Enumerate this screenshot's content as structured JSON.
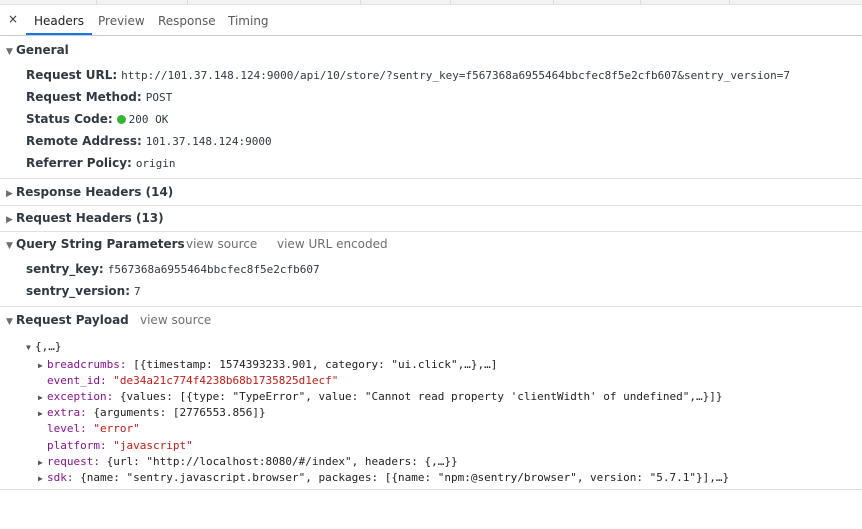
{
  "tabs": {
    "close": "×",
    "headers": "Headers",
    "preview": "Preview",
    "response": "Response",
    "timing": "Timing"
  },
  "general": {
    "title": "General",
    "request_url_label": "Request URL:",
    "request_url": "http://101.37.148.124:9000/api/10/store/?sentry_key=f567368a6955464bbcfec8f5e2cfb607&sentry_version=7",
    "request_method_label": "Request Method:",
    "request_method": "POST",
    "status_code_label": "Status Code:",
    "status_code": "200 OK",
    "status_color": "#35b535",
    "remote_address_label": "Remote Address:",
    "remote_address": "101.37.148.124:9000",
    "referrer_policy_label": "Referrer Policy:",
    "referrer_policy": "origin"
  },
  "response_headers": {
    "title": "Response Headers (14)"
  },
  "request_headers": {
    "title": "Request Headers (13)"
  },
  "query": {
    "title": "Query String Parameters",
    "view_source": "view source",
    "view_url_encoded": "view URL encoded",
    "params": [
      {
        "key": "sentry_key:",
        "value": "f567368a6955464bbcfec8f5e2cfb607"
      },
      {
        "key": "sentry_version:",
        "value": "7"
      }
    ]
  },
  "payload": {
    "title": "Request Payload",
    "view_source": "view source",
    "root": "{,…}",
    "rows": [
      {
        "key": "breadcrumbs:",
        "value": "[{timestamp: 1574393233.901, category: \"ui.click\",…},…]",
        "expandable": true,
        "string": false
      },
      {
        "key": "event_id:",
        "value": "\"de34a21c774f4238b68b1735825d1ecf\"",
        "expandable": false,
        "string": true
      },
      {
        "key": "exception:",
        "value": "{values: [{type: \"TypeError\", value: \"Cannot read property 'clientWidth' of undefined\",…}]}",
        "expandable": true,
        "string": false
      },
      {
        "key": "extra:",
        "value": "{arguments: [2776553.856]}",
        "expandable": true,
        "string": false
      },
      {
        "key": "level:",
        "value": "\"error\"",
        "expandable": false,
        "string": true
      },
      {
        "key": "platform:",
        "value": "\"javascript\"",
        "expandable": false,
        "string": true
      },
      {
        "key": "request:",
        "value": "{url: \"http://localhost:8080/#/index\", headers: {,…}}",
        "expandable": true,
        "string": false
      },
      {
        "key": "sdk:",
        "value": "{name: \"sentry.javascript.browser\", packages: [{name: \"npm:@sentry/browser\", version: \"5.7.1\"}],…}",
        "expandable": true,
        "string": false
      }
    ]
  }
}
